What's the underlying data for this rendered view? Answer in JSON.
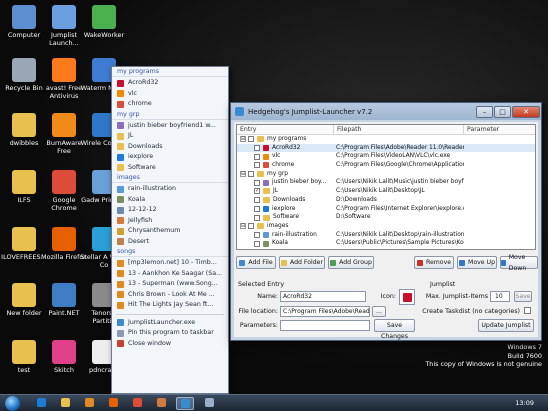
{
  "desktop_icons": [
    {
      "label": "Computer",
      "icon": "computer-icon",
      "color": "#5d8fd0"
    },
    {
      "label": "Jumplist Launch...",
      "icon": "jumplist-launcher-icon",
      "color": "#6a9fe0"
    },
    {
      "label": "WakeWorker",
      "icon": "wakeworker-icon",
      "color": "#4caf50"
    },
    {
      "label": "Recycle Bin",
      "icon": "recycle-bin-icon",
      "color": "#9aa6b6"
    },
    {
      "label": "avast! Free Antivirus",
      "icon": "avast-icon",
      "color": "#ff7a1a"
    },
    {
      "label": "Waterm Magic",
      "icon": "watermark-magic-icon",
      "color": "#3e7bd1"
    },
    {
      "label": "dwibbles",
      "icon": "folder-icon",
      "color": "#e8c050"
    },
    {
      "label": "BurnAware Free",
      "icon": "burnaware-icon",
      "color": "#f28a1a"
    },
    {
      "label": "Wirele Connec",
      "icon": "wireless-icon",
      "color": "#2f77c8"
    },
    {
      "label": "ILFS",
      "icon": "folder-icon",
      "color": "#e8c050"
    },
    {
      "label": "Google Chrome",
      "icon": "chrome-icon",
      "color": "#dd4b39"
    },
    {
      "label": "Gadw PrintScr",
      "icon": "printscreen-icon",
      "color": "#6aa0d8"
    },
    {
      "label": "ILOVEFREES...",
      "icon": "folder-icon",
      "color": "#e8c050"
    },
    {
      "label": "Mozilla Firefox",
      "icon": "firefox-icon",
      "color": "#e66000"
    },
    {
      "label": "Stellar A Video Co",
      "icon": "stellar-icon",
      "color": "#2a9fd6"
    },
    {
      "label": "New folder",
      "icon": "folder-icon",
      "color": "#e8c050"
    },
    {
      "label": "Paint.NET",
      "icon": "paintnet-icon",
      "color": "#3c7dc4"
    },
    {
      "label": "Tenorsh Partitio",
      "icon": "tenorshare-icon",
      "color": "#8a8a8a"
    },
    {
      "label": "test",
      "icon": "folder-icon",
      "color": "#e8c050"
    },
    {
      "label": "Skitch",
      "icon": "skitch-icon",
      "color": "#e0408a"
    },
    {
      "label": "pdncrash",
      "icon": "text-file-icon",
      "color": "#eeeeee"
    }
  ],
  "jumplist": {
    "sections": [
      {
        "title": "my programs",
        "items": [
          {
            "label": "AcroRd32",
            "icon": "acrobat-icon",
            "color": "#c8102e"
          },
          {
            "label": "vlc",
            "icon": "vlc-icon",
            "color": "#f08a00"
          },
          {
            "label": "chrome",
            "icon": "chrome-icon",
            "color": "#dd4b39"
          }
        ]
      },
      {
        "title": "my grp",
        "items": [
          {
            "label": "justin bieber boyfriend1 w...",
            "icon": "media-file-icon",
            "color": "#8a6fc0"
          },
          {
            "label": "JL",
            "icon": "folder-icon",
            "color": "#e8c050"
          },
          {
            "label": "Downloads",
            "icon": "folder-icon",
            "color": "#e8c050"
          },
          {
            "label": "iexplore",
            "icon": "ie-icon",
            "color": "#1e7bd6"
          },
          {
            "label": "Software",
            "icon": "folder-icon",
            "color": "#e8c050"
          }
        ]
      },
      {
        "title": "images",
        "items": [
          {
            "label": "rain-illustration",
            "icon": "image-icon",
            "color": "#5a9ad6"
          },
          {
            "label": "Koala",
            "icon": "image-icon",
            "color": "#7a9060"
          },
          {
            "label": "12-12-12",
            "icon": "image-icon",
            "color": "#6a8ab0"
          },
          {
            "label": "Jellyfish",
            "icon": "image-icon",
            "color": "#d07a40"
          },
          {
            "label": "Chrysanthemum",
            "icon": "image-icon",
            "color": "#d0a030"
          },
          {
            "label": "Desert",
            "icon": "image-icon",
            "color": "#c08050"
          }
        ]
      },
      {
        "title": "songs",
        "items": [
          {
            "label": "[mp3lemon.net] 10 - Timb...",
            "icon": "music-icon",
            "color": "#e08a20"
          },
          {
            "label": "13 - Aankhon Ke Saagar (Sa...",
            "icon": "music-icon",
            "color": "#e08a20"
          },
          {
            "label": "13 - Superman (www.Song...",
            "icon": "music-icon",
            "color": "#e08a20"
          },
          {
            "label": "Chris Brown - Look At Me ...",
            "icon": "music-icon",
            "color": "#e08a20"
          },
          {
            "label": "Hit The Lights    Jay Sean ft...",
            "icon": "music-icon",
            "color": "#e08a20"
          }
        ]
      }
    ],
    "tasks": [
      {
        "label": "JumplistLauncher.exe",
        "icon": "app-icon",
        "color": "#3a8ad0"
      },
      {
        "label": "Pin this program to taskbar",
        "icon": "pin-icon",
        "color": "#8a9ab0"
      },
      {
        "label": "Close window",
        "icon": "close-icon",
        "color": "#c84030"
      }
    ]
  },
  "window": {
    "title": "Hedgehog's Jumplist-Launcher v7.2",
    "min": "–",
    "max": "□",
    "close": "✕",
    "columns": [
      "Entry",
      "Filepath",
      "Parameter"
    ],
    "rows": [
      {
        "indent": 0,
        "type": "group",
        "expander": "⊟",
        "checked": "",
        "label": "my programs",
        "path": "",
        "param": ""
      },
      {
        "indent": 1,
        "type": "item",
        "expander": "",
        "checked": "",
        "label": "AcroRd32",
        "path": "C:\\Program Files\\Adobe\\Reader 11.0\\Reader",
        "param": "",
        "selected": true,
        "color": "#c8102e"
      },
      {
        "indent": 1,
        "type": "item",
        "expander": "",
        "checked": "",
        "label": "vlc",
        "path": "C:\\Program Files\\VideoLAN\\VLC\\vlc.exe",
        "param": "",
        "color": "#f08a00"
      },
      {
        "indent": 1,
        "type": "item",
        "expander": "",
        "checked": "",
        "label": "chrome",
        "path": "C:\\Program Files\\Google\\Chrome\\Application\\...",
        "param": "",
        "color": "#dd4b39"
      },
      {
        "indent": 0,
        "type": "group",
        "expander": "⊟",
        "checked": "",
        "label": "my grp",
        "path": "",
        "param": ""
      },
      {
        "indent": 1,
        "type": "item",
        "expander": "",
        "checked": "",
        "label": "justin bieber boy...",
        "path": "C:\\Users\\Nikik Lalit\\Music\\justin bieber boyfri...",
        "param": "",
        "color": "#8a6fc0"
      },
      {
        "indent": 1,
        "type": "folder",
        "expander": "",
        "checked": "✓",
        "label": "JL",
        "path": "C:\\Users\\Nikik Lalit\\Desktop\\JL",
        "param": ""
      },
      {
        "indent": 1,
        "type": "folder",
        "expander": "",
        "checked": "",
        "label": "Downloads",
        "path": "D:\\Downloads",
        "param": ""
      },
      {
        "indent": 1,
        "type": "item",
        "expander": "",
        "checked": "",
        "label": "iexplore",
        "path": "C:\\Program Files\\Internet Explorer\\iexplore.exe",
        "param": "",
        "color": "#1e7bd6"
      },
      {
        "indent": 1,
        "type": "folder",
        "expander": "",
        "checked": "",
        "label": "Software",
        "path": "D:\\Software",
        "param": ""
      },
      {
        "indent": 0,
        "type": "group",
        "expander": "⊟",
        "checked": "",
        "label": "images",
        "path": "",
        "param": ""
      },
      {
        "indent": 1,
        "type": "item",
        "expander": "",
        "checked": "",
        "label": "rain-illustration",
        "path": "C:\\Users\\Nikik Lalit\\Desktop\\rain-illustration.jpg",
        "param": "",
        "color": "#5a9ad6"
      },
      {
        "indent": 1,
        "type": "item",
        "expander": "",
        "checked": "",
        "label": "Koala",
        "path": "C:\\Users\\Public\\Pictures\\Sample Pictures\\Koala",
        "param": "",
        "color": "#7a9060"
      },
      {
        "indent": 1,
        "type": "item",
        "expander": "",
        "checked": "",
        "label": "",
        "path": "",
        "param": "",
        "color": "#6a8ab0"
      }
    ],
    "buttons": {
      "add_file": "Add File",
      "add_folder": "Add Folder",
      "add_group": "Add Group",
      "remove": "Remove",
      "move_up": "Move Up",
      "move_down": "Move Down"
    },
    "selected_entry": {
      "title": "Selected Entry",
      "name_label": "Name:",
      "name_value": "AcroRd32",
      "icon_label": "Icon:",
      "location_label": "File location:",
      "location_value": "C:\\Program Files\\Adobe\\Reader 1",
      "browse": "...",
      "params_label": "Parameters:",
      "params_value": "",
      "save": "Save Changes"
    },
    "jumplist_box": {
      "title": "Jumplist",
      "max_label": "Max. Jumplist-Items",
      "max_value": "10",
      "save": "Save",
      "taskdef_label": "Create Taskdist (no categories)",
      "update": "Update Jumplist"
    }
  },
  "watermark": [
    "Windows 7",
    "Build 7600",
    "This copy of Windows is not genuine"
  ],
  "taskbar": {
    "clock": "13:09",
    "icons": [
      {
        "icon": "ie-icon",
        "color": "#1e7bd6"
      },
      {
        "icon": "explorer-icon",
        "color": "#e8c050"
      },
      {
        "icon": "media-player-icon",
        "color": "#e08a20"
      },
      {
        "icon": "firefox-icon",
        "color": "#e66000"
      },
      {
        "icon": "chrome-icon",
        "color": "#dd4b39"
      },
      {
        "icon": "paint-icon",
        "color": "#d07a40"
      },
      {
        "icon": "jumplist-launcher-icon",
        "color": "#3a8ad0"
      },
      {
        "icon": "snipping-icon",
        "color": "#9ab0c8"
      }
    ]
  }
}
